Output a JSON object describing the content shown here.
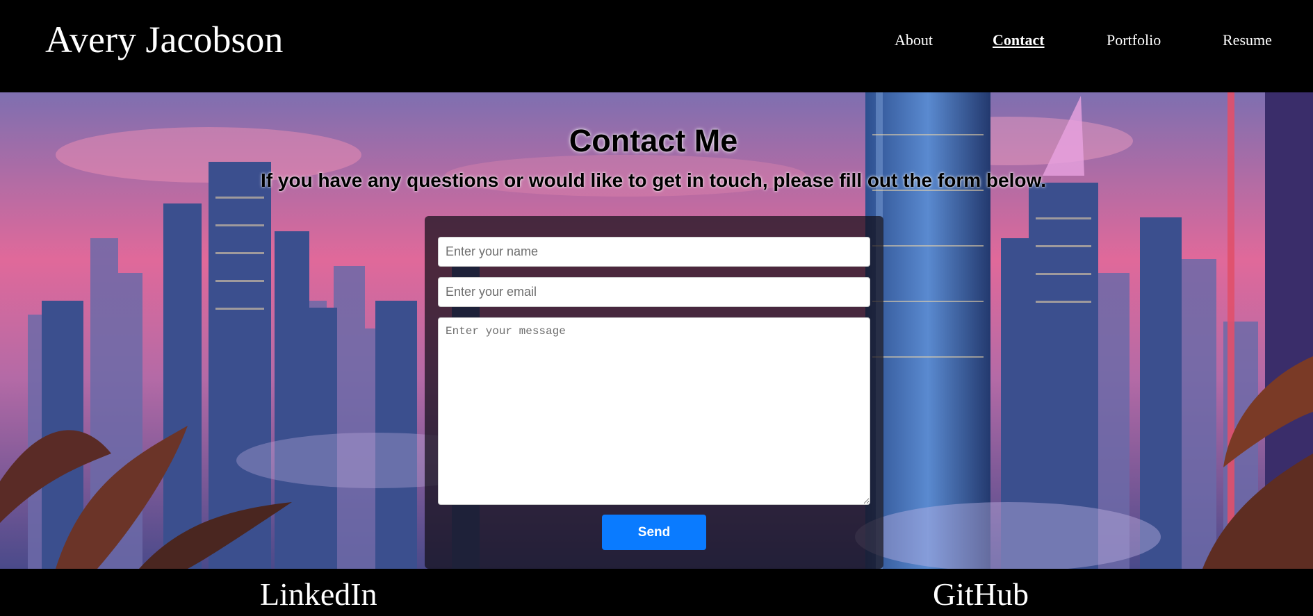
{
  "header": {
    "site_name": "Avery Jacobson",
    "nav": [
      "About",
      "Contact",
      "Portfolio",
      "Resume"
    ],
    "active_nav": "Contact"
  },
  "hero": {
    "title": "Contact Me",
    "subtitle": "If you have any questions or would like to get in touch, please fill out the form below."
  },
  "form": {
    "name_placeholder": "Enter your name",
    "email_placeholder": "Enter your email",
    "message_placeholder": "Enter your message",
    "send_label": "Send"
  },
  "footer": {
    "links": [
      "LinkedIn",
      "GitHub"
    ]
  },
  "colors": {
    "header_bg": "#000000",
    "send_button": "#0a7bff",
    "sky_top": "#7e6fb0",
    "sky_mid": "#e0699a"
  }
}
